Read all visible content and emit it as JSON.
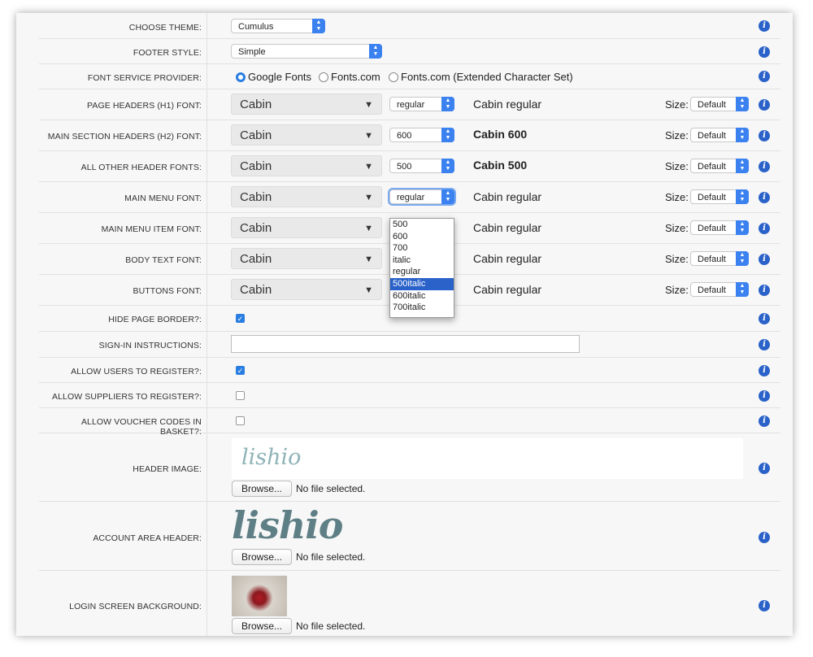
{
  "rows": {
    "theme": {
      "label": "CHOOSE THEME:",
      "value": "Cumulus"
    },
    "footer": {
      "label": "FOOTER STYLE:",
      "value": "Simple"
    },
    "provider": {
      "label": "FONT SERVICE PROVIDER:",
      "options": [
        "Google Fonts",
        "Fonts.com",
        "Fonts.com (Extended Character Set)"
      ],
      "selected": "Google Fonts"
    },
    "h1": {
      "label": "PAGE HEADERS (H1) FONT:",
      "font": "Cabin",
      "weight": "regular",
      "preview": "Cabin regular",
      "size_label": "Size:",
      "size": "Default"
    },
    "h2": {
      "label": "MAIN SECTION HEADERS (H2) FONT:",
      "font": "Cabin",
      "weight": "600",
      "preview": "Cabin 600",
      "size_label": "Size:",
      "size": "Default"
    },
    "other_headers": {
      "label": "ALL OTHER HEADER FONTS:",
      "font": "Cabin",
      "weight": "500",
      "preview": "Cabin 500",
      "size_label": "Size:",
      "size": "Default"
    },
    "main_menu": {
      "label": "MAIN MENU FONT:",
      "font": "Cabin",
      "weight": "regular",
      "preview": "Cabin regular",
      "size_label": "Size:",
      "size": "Default"
    },
    "main_menu_item": {
      "label": "MAIN MENU ITEM FONT:",
      "font": "Cabin",
      "preview": "Cabin regular",
      "size_label": "Size:",
      "size": "Default"
    },
    "body_text": {
      "label": "BODY TEXT FONT:",
      "font": "Cabin",
      "preview": "Cabin regular",
      "size_label": "Size:",
      "size": "Default"
    },
    "buttons": {
      "label": "BUTTONS FONT:",
      "font": "Cabin",
      "preview": "Cabin regular",
      "size_label": "Size:",
      "size": "Default"
    },
    "hide_border": {
      "label": "HIDE PAGE BORDER?:",
      "checked": true
    },
    "signin": {
      "label": "SIGN-IN INSTRUCTIONS:",
      "value": ""
    },
    "allow_users": {
      "label": "ALLOW USERS TO REGISTER?:",
      "checked": true
    },
    "allow_suppliers": {
      "label": "ALLOW SUPPLIERS TO REGISTER?:",
      "checked": false
    },
    "allow_vouchers": {
      "label": "ALLOW VOUCHER CODES IN BASKET?:",
      "checked": false
    },
    "header_image": {
      "label": "HEADER IMAGE:",
      "logo_text": "lishio",
      "browse": "Browse...",
      "file": "No file selected."
    },
    "account_header": {
      "label": "ACCOUNT AREA HEADER:",
      "logo_text": "lishio",
      "browse": "Browse...",
      "file": "No file selected."
    },
    "login_bg": {
      "label": "LOGIN SCREEN BACKGROUND:",
      "browse": "Browse...",
      "file": "No file selected."
    }
  },
  "weight_dropdown": {
    "options": [
      "500",
      "600",
      "700",
      "italic",
      "regular",
      "500italic",
      "600italic",
      "700italic"
    ],
    "highlighted": "500italic"
  },
  "colors": {
    "accent": "#2a62c9",
    "select_arrow": "#3b82f0"
  }
}
